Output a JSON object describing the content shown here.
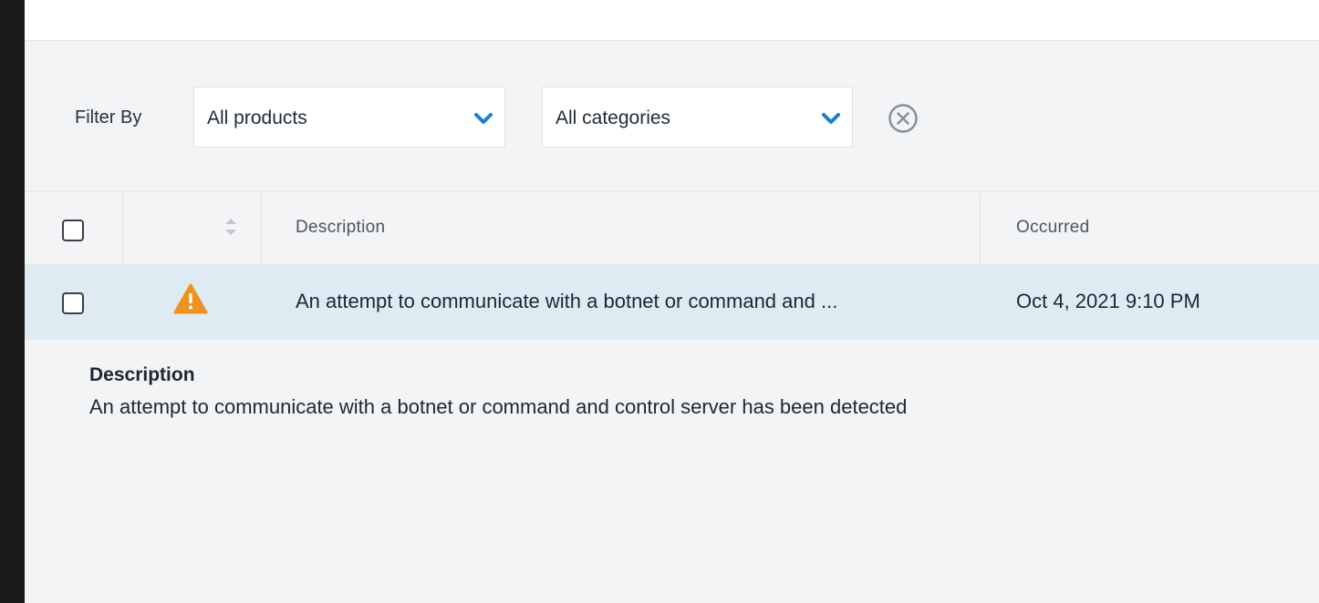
{
  "filters": {
    "label": "Filter By",
    "product_select": {
      "value": "All products"
    },
    "category_select": {
      "value": "All categories"
    }
  },
  "table": {
    "headers": {
      "description": "Description",
      "occurred": "Occurred"
    },
    "rows": [
      {
        "severity_icon": "warning-triangle-icon",
        "description": "An attempt to communicate with a botnet or command and ...",
        "occurred": "Oct 4, 2021 9:10 PM"
      }
    ]
  },
  "detail": {
    "title": "Description",
    "text": "An attempt to communicate with a botnet or command and control server has been detected"
  },
  "colors": {
    "accent": "#1a7fd4",
    "warning": "#f0921e",
    "selected_row": "#deebf3",
    "background": "#f3f4f6"
  }
}
